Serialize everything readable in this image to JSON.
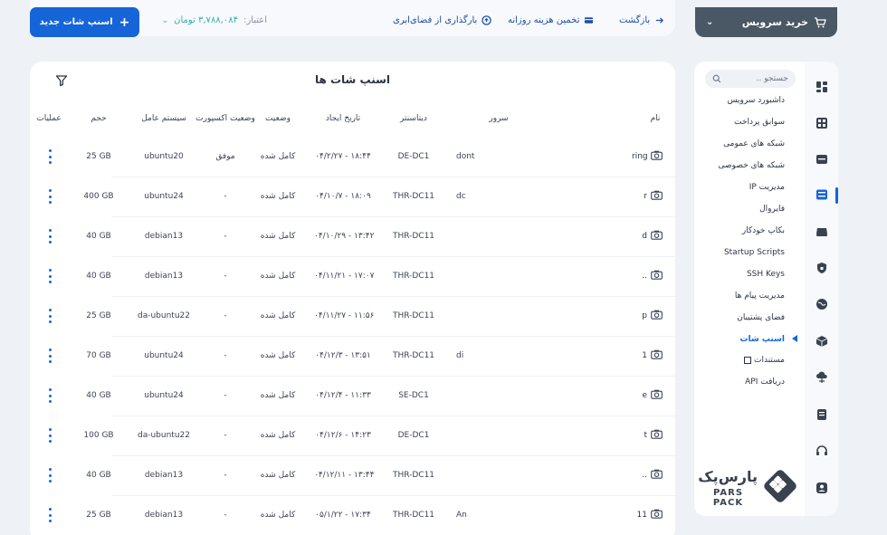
{
  "header": {
    "new_snapshot_label": "اسنپ شات جدید",
    "credit_label": "اعتبار:",
    "credit_amount": "۳,۷۸۸,۰۸۴ تومان",
    "upload_label": "بارگذاری از فضای‌ابری",
    "daily_cost_label": "تخمین هزینه روزانه",
    "back_label": "بازگشت",
    "buy_service_label": "خرید سرویس"
  },
  "page": {
    "title": "اسنپ شات ها"
  },
  "table": {
    "columns": {
      "name": "نام",
      "server": "سرور",
      "datacenter": "دیتاسنتر",
      "created": "تاریخ ایجاد",
      "status": "وضعیت",
      "export_status": "وضعیت اکسپورت",
      "os": "سیستم عامل",
      "size": "حجم",
      "actions": "عملیات"
    },
    "rows": [
      {
        "name": "ring",
        "server": "dont",
        "datacenter": "DE-DC1",
        "created": "۰۴/۲/۲۷ - ۱۸:۴۴",
        "status": "کامل شده",
        "export": "موفق",
        "os": "ubuntu20",
        "size": "25 GB"
      },
      {
        "name": "r",
        "server": "dc",
        "datacenter": "THR-DC11",
        "created": "۰۴/۱۰/۷ - ۱۸:۰۹",
        "status": "کامل شده",
        "export": "-",
        "os": "ubuntu24",
        "size": "400 GB"
      },
      {
        "name": "d",
        "server": "",
        "datacenter": "THR-DC11",
        "created": "۰۴/۱۰/۲۹ - ۱۳:۴۲",
        "status": "کامل شده",
        "export": "-",
        "os": "debian13",
        "size": "40 GB"
      },
      {
        "name": "..",
        "server": "",
        "datacenter": "THR-DC11",
        "created": "۰۴/۱۱/۲۱ - ۱۷:۰۷",
        "status": "کامل شده",
        "export": "-",
        "os": "debian13",
        "size": "40 GB"
      },
      {
        "name": "p",
        "server": "",
        "datacenter": "THR-DC11",
        "created": "۰۴/۱۱/۲۷ - ۱۱:۵۶",
        "status": "کامل شده",
        "export": "-",
        "os": "da-ubuntu22",
        "size": "25 GB"
      },
      {
        "name": "1",
        "server": "di",
        "datacenter": "THR-DC11",
        "created": "۰۴/۱۲/۳ - ۱۳:۵۱",
        "status": "کامل شده",
        "export": "-",
        "os": "ubuntu24",
        "size": "70 GB"
      },
      {
        "name": "e",
        "server": "",
        "datacenter": "SE-DC1",
        "created": "۰۴/۱۲/۴ - ۱۱:۳۳",
        "status": "کامل شده",
        "export": "-",
        "os": "ubuntu24",
        "size": "40 GB"
      },
      {
        "name": "t",
        "server": "",
        "datacenter": "DE-DC1",
        "created": "۰۴/۱۲/۶ - ۱۴:۲۳",
        "status": "کامل شده",
        "export": "-",
        "os": "da-ubuntu22",
        "size": "100 GB"
      },
      {
        "name": "..",
        "server": "",
        "datacenter": "THR-DC11",
        "created": "۰۴/۱۲/۱۱ - ۱۳:۴۴",
        "status": "کامل شده",
        "export": "-",
        "os": "debian13",
        "size": "40 GB"
      },
      {
        "name": "11",
        "server": "An",
        "datacenter": "THR-DC11",
        "created": "۰۵/۱/۲۲ - ۱۷:۳۴",
        "status": "کامل شده",
        "export": "-",
        "os": "debian13",
        "size": "25 GB"
      }
    ]
  },
  "sidebar": {
    "search_placeholder": "جستجو ..",
    "items": [
      {
        "label": "داشبورد سرویس"
      },
      {
        "label": "سوابق پرداخت"
      },
      {
        "label": "شبکه های عمومی"
      },
      {
        "label": "شبکه های خصوصی"
      },
      {
        "label": "مدیریت IP"
      },
      {
        "label": "فایروال"
      },
      {
        "label": "بکاپ خودکار"
      },
      {
        "label": "Startup Scripts"
      },
      {
        "label": "SSH Keys"
      },
      {
        "label": "مدیریت پیام ها"
      },
      {
        "label": "فضای پشتیبان"
      },
      {
        "label": "اسنپ شات"
      },
      {
        "label": "مستندات"
      },
      {
        "label": "دریافت API"
      }
    ],
    "active_item": "اسنپ شات"
  },
  "brand": {
    "name_fa": "پارس‌پک",
    "name_en": "PARS PACK"
  },
  "colors": {
    "primary": "#1565d8",
    "credit": "#35b1a5",
    "buy_button": "#4a5764"
  }
}
